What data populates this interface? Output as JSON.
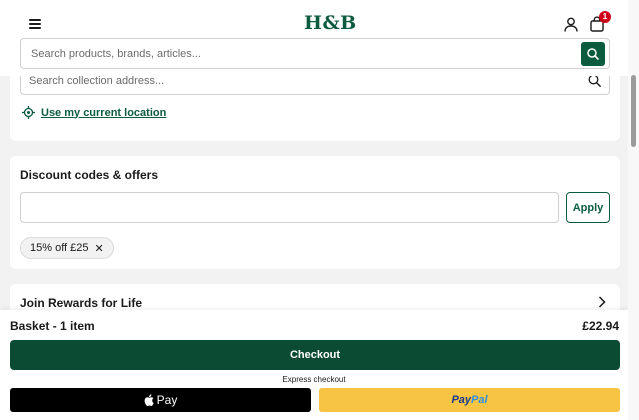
{
  "header": {
    "logo": "H&B",
    "cart_count": "1",
    "search": {
      "placeholder": "Search products, brands, articles..."
    }
  },
  "collection": {
    "placeholder": "Search collection address...",
    "location_link": "Use my current location"
  },
  "discount": {
    "title": "Discount codes & offers",
    "input_value": "",
    "apply_label": "Apply",
    "applied_offer": "15% off £25"
  },
  "rewards": {
    "label": "Join Rewards for Life"
  },
  "basket": {
    "label": "Basket - 1 item",
    "total": "£22.94",
    "checkout_label": "Checkout",
    "express_label": "Express checkout",
    "applepay_label": "Pay",
    "paypal_part1": "Pay",
    "paypal_part2": "Pal"
  },
  "colors": {
    "brand": "#0b5c3f",
    "checkout": "#0b4a33",
    "badge": "#d0021b",
    "paypal_bg": "#f7c443"
  },
  "icons": [
    "menu-icon",
    "user-icon",
    "shopping-bag-icon",
    "search-icon",
    "location-target-icon",
    "close-icon",
    "chevron-right-icon",
    "apple-icon"
  ]
}
